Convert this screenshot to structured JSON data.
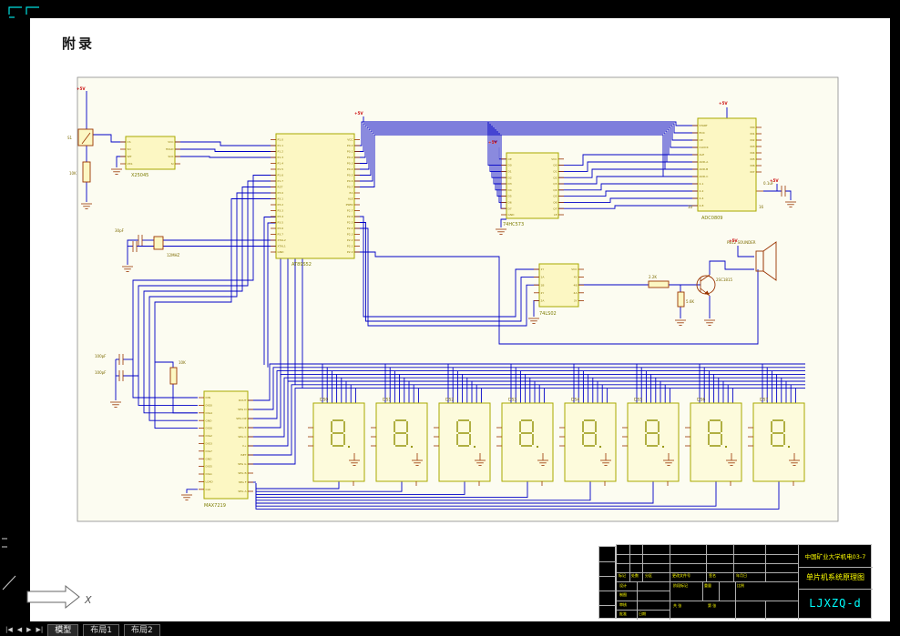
{
  "colors": {
    "wire": "#0000c6",
    "chip_fill": "#fcf7c3",
    "chip_border": "#a9a900",
    "pin": "#993300",
    "value_label": "#7c6a00",
    "power": "#cc1111",
    "titleblock_text": "#ffff00",
    "drawing_number": "#00ffff"
  },
  "page": {
    "title": "附录"
  },
  "schematic": {
    "chips": [
      {
        "id": "x25045",
        "name": "X25045",
        "pins_left": [
          "CS",
          "SO",
          "WP",
          "VSS"
        ],
        "pins_right": [
          "VCC",
          "HOLD",
          "SCK",
          "SI"
        ]
      },
      {
        "id": "at89s52",
        "name": "AT89S52",
        "pins_left": [
          "P1.0",
          "P1.1",
          "P1.2",
          "P1.3",
          "P1.4",
          "P1.5",
          "P1.6",
          "P1.7",
          "RST",
          "P3.0",
          "P3.1",
          "P3.2",
          "P3.3",
          "P3.4",
          "P3.5",
          "P3.6",
          "P3.7",
          "XTAL2",
          "XTAL1",
          "GND"
        ],
        "pins_right": [
          "VCC",
          "P0.0",
          "P0.1",
          "P0.2",
          "P0.3",
          "P0.4",
          "P0.5",
          "P0.6",
          "P0.7",
          "EA",
          "ALE",
          "PSEN",
          "P2.7",
          "P2.6",
          "P2.5",
          "P2.4",
          "P2.3",
          "P2.2",
          "P2.1",
          "P2.0"
        ]
      },
      {
        "id": "hc573",
        "name": "74HC573",
        "pins_left": [
          "OE",
          "D0",
          "D1",
          "D2",
          "D3",
          "D4",
          "D5",
          "D6",
          "D7",
          "GND"
        ],
        "pins_right": [
          "VCC",
          "Q0",
          "Q1",
          "Q2",
          "Q3",
          "Q4",
          "Q5",
          "Q6",
          "Q7",
          "LE"
        ]
      },
      {
        "id": "adc0809",
        "name": "ADC0809",
        "pins_left": [
          "START",
          "EOC",
          "OE",
          "CLOCK",
          "ALE",
          "ADD-A",
          "ADD-B",
          "ADD-C",
          "2-1",
          "2-2",
          "2-4",
          "2-8"
        ],
        "pins_right": [
          "IN0",
          "IN1",
          "IN2",
          "IN3",
          "IN4",
          "IN5",
          "IN6",
          "IN7"
        ]
      },
      {
        "id": "ls02",
        "name": "74LS02",
        "pins_left": [
          "1Y",
          "1A",
          "1B",
          "2Y",
          "2A"
        ],
        "pins_right": [
          "VCC",
          "4Y",
          "4B",
          "4A",
          "3Y"
        ]
      },
      {
        "id": "max7219",
        "name": "MAX7219",
        "pins_left": [
          "DIN",
          "DIG0",
          "DIG4",
          "GND",
          "DIG6",
          "DIG2",
          "DIG3",
          "DIG7",
          "GND",
          "DIG5",
          "DIG1",
          "LOAD",
          "CLK"
        ],
        "pins_right": [
          "DOUT",
          "SEG D",
          "SEG DP",
          "SEG E",
          "SEG C",
          "V+",
          "ISET",
          "SEG G",
          "SEG B",
          "SEG F",
          "SEG A"
        ]
      }
    ],
    "display_labels": [
      "DS0",
      "DS1",
      "DS2",
      "DS3",
      "DS4",
      "DS5",
      "DS6",
      "DS7"
    ],
    "values": {
      "s1": "S1",
      "r1": "10K",
      "xtal": "12MHZ",
      "c_xtal": "30pF",
      "c1": "100pF",
      "c2": "100pF",
      "r2": "10K",
      "r3": "2.2K",
      "r4": "5.6K",
      "q1": "2SC1815",
      "speaker": "PB12 SOUNDER",
      "c3": "0.1uF",
      "pin16": "16",
      "pin10": "10",
      "plus5v": "+5V"
    }
  },
  "title_block": {
    "school": "中国矿业大学机电03-7",
    "drawing_title": "单片机系统原理图",
    "drawing_number": "LJXZQ-d",
    "small_labels": [
      "设计",
      "制图",
      "审核",
      "批准",
      "阶段标记",
      "重量",
      "比例",
      "共 张",
      "第 张",
      "日期",
      "签名",
      "年月日",
      "标记",
      "处数",
      "分区",
      "更改文件号"
    ]
  },
  "status_bar": {
    "nav_glyphs": [
      "|◀",
      "◀",
      "▶",
      "▶|"
    ],
    "tabs": [
      "模型",
      "布局1",
      "布局2"
    ]
  }
}
